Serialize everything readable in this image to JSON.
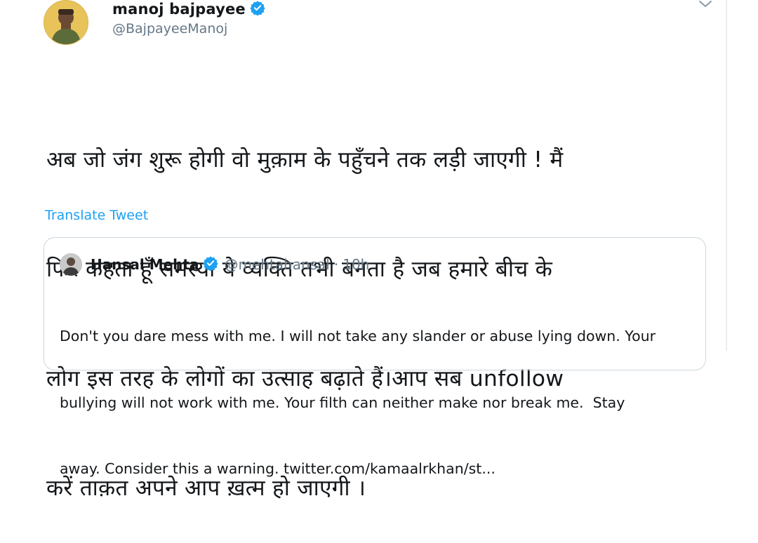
{
  "tweet": {
    "author_name": "manoj bajpayee",
    "author_handle": "@BajpayeeManoj",
    "text_lines": [
      "अब जो जंग शुरू होगी वो मुक़ाम के पहुँचने तक लड़ी जाएगी ! मैं",
      "फिर कहता हूँ समस्या ये व्यक्ति तभी बनता है जब हमारे बीच के",
      "लोग इस तरह के लोगों का उत्साह बढ़ाते हैं।आप सब unfollow",
      "करें ताक़त अपने आप ख़त्म हो जाएगी ।"
    ],
    "translate_label": "Translate Tweet"
  },
  "quote": {
    "author_name": "Hansal Mehta",
    "author_handle": "@mehtahansal",
    "separator": "·",
    "time": "10h",
    "text_lines": [
      "Don't you dare mess with me. I will not take any slander or abuse lying down. Your",
      "bullying will not work with me. Your filth can neither make nor break me.  Stay",
      "away. Consider this a warning. twitter.com/kamaalrkhan/st..."
    ]
  },
  "icons": {
    "verified": "verified-badge-icon",
    "menu": "chevron-down-icon"
  },
  "colors": {
    "link": "#1da1f2",
    "secondary_text": "#657786",
    "border": "#ccd6dd",
    "verified": "#1da1f2"
  }
}
